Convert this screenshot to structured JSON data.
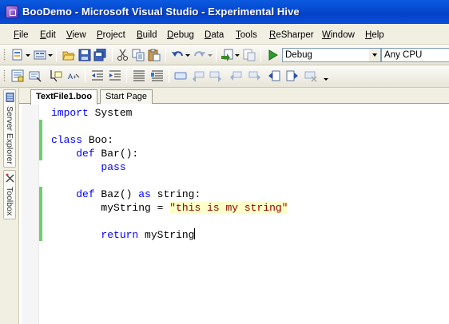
{
  "window": {
    "title": "BooDemo - Microsoft Visual Studio - Experimental Hive"
  },
  "menu": [
    {
      "label": "File",
      "accel": "F",
      "rest": "ile"
    },
    {
      "label": "Edit",
      "accel": "E",
      "rest": "dit"
    },
    {
      "label": "View",
      "accel": "V",
      "rest": "iew"
    },
    {
      "label": "Project",
      "accel": "P",
      "rest": "roject"
    },
    {
      "label": "Build",
      "accel": "B",
      "rest": "uild"
    },
    {
      "label": "Debug",
      "accel": "D",
      "rest": "ebug"
    },
    {
      "label": "Data",
      "accel": "D",
      "rest": "ata"
    },
    {
      "label": "Tools",
      "accel": "T",
      "rest": "ools"
    },
    {
      "label": "ReSharper",
      "accel": "R",
      "rest": "eSharper"
    },
    {
      "label": "Window",
      "accel": "W",
      "rest": "indow"
    },
    {
      "label": "Help",
      "accel": "H",
      "rest": "elp"
    }
  ],
  "toolbar": {
    "config_value": "Debug",
    "platform_value": "Any CPU"
  },
  "side_panels": {
    "server_explorer": "Server Explorer",
    "toolbox": "Toolbox"
  },
  "tabs": [
    {
      "label": "TextFile1.boo",
      "active": true
    },
    {
      "label": "Start Page",
      "active": false
    }
  ],
  "code": {
    "line1": {
      "kw": "import",
      "rest": " System"
    },
    "line3": {
      "kw": "class",
      "rest": " Boo:"
    },
    "line4": {
      "indent": "    ",
      "kw": "def",
      "rest": " Bar():"
    },
    "line5": {
      "indent": "        ",
      "kw": "pass"
    },
    "line7": {
      "indent": "    ",
      "kw": "def",
      "mid": " Baz() ",
      "kw2": "as",
      "rest": " string:"
    },
    "line8": {
      "indent": "        ",
      "pre": "myString = ",
      "str": "\"this is my string\""
    },
    "line10": {
      "indent": "        ",
      "kw": "return",
      "rest": " myString"
    }
  },
  "colors": {
    "keyword": "#0000ff",
    "string": "#8b0000",
    "string_highlight": "#ffffc8",
    "change_bar": "#6ad06a",
    "titlebar": "#0a5ae0"
  }
}
